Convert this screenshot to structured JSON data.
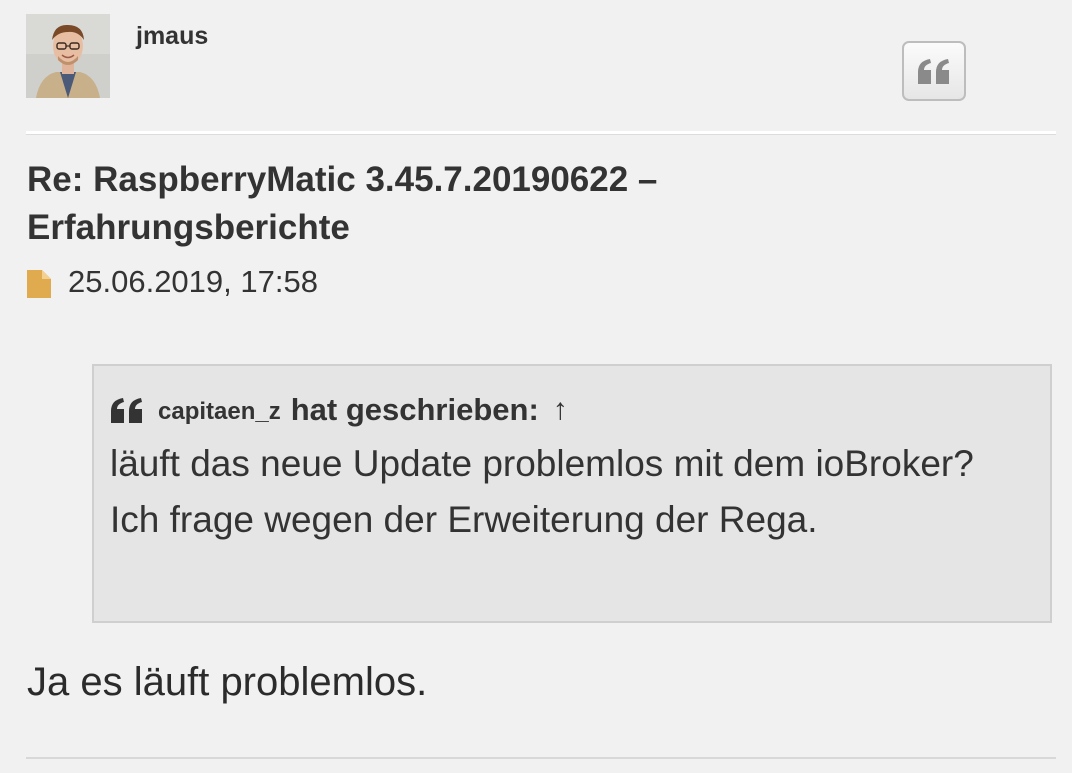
{
  "author": {
    "username": "jmaus"
  },
  "actions": {
    "quote_button_icon": "quote-icon"
  },
  "post": {
    "title": "Re: RaspberryMatic 3.45.7.20190622 – Erfahrungsberichte",
    "date_icon": "file-icon",
    "timestamp": "25.06.2019, 17:58",
    "quote": {
      "icon": "quote-icon",
      "author": "capitaen_z",
      "label": "hat geschrieben:",
      "arrow": "↑",
      "text": "läuft das neue Update problemlos mit dem ioBroker? Ich frage wegen der Erweiterung der Rega."
    },
    "body": "Ja es läuft problemlos."
  },
  "colors": {
    "background": "#f1f1f1",
    "quote_background": "#e5e5e5",
    "file_icon": "#e0ab4f",
    "text": "#333333"
  }
}
